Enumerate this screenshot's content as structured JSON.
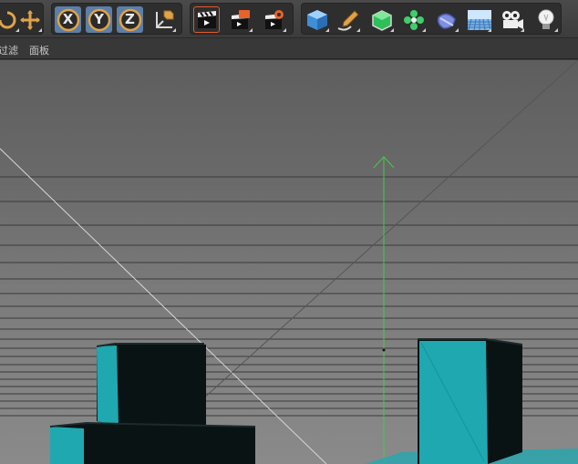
{
  "toolbar": {
    "groups": [
      {
        "name": "transform-tools",
        "buttons": [
          {
            "name": "rotate-tool-icon",
            "icon": "rotate"
          },
          {
            "name": "move-tool-icon",
            "icon": "move-cross"
          }
        ]
      },
      {
        "name": "axis-lock",
        "buttons": [
          {
            "name": "x-axis-lock-button",
            "label": "X"
          },
          {
            "name": "y-axis-lock-button",
            "label": "Y"
          },
          {
            "name": "z-axis-lock-button",
            "label": "Z"
          },
          {
            "name": "coordinate-system-button",
            "icon": "world-axis"
          }
        ]
      },
      {
        "name": "render",
        "buttons": [
          {
            "name": "render-view-button",
            "icon": "clapper-active"
          },
          {
            "name": "render-to-picture-viewer-button",
            "icon": "clapper-orange"
          },
          {
            "name": "render-settings-button",
            "icon": "clapper-gear"
          }
        ]
      },
      {
        "name": "create-objects",
        "buttons": [
          {
            "name": "cube-object-button",
            "icon": "cube"
          },
          {
            "name": "pen-spline-button",
            "icon": "pen"
          },
          {
            "name": "subdivision-button",
            "icon": "green-cube"
          },
          {
            "name": "cloner-button",
            "icon": "cloner"
          },
          {
            "name": "deformer-button",
            "icon": "deformer"
          },
          {
            "name": "floor-button",
            "icon": "floor"
          },
          {
            "name": "camera-button",
            "icon": "camera"
          },
          {
            "name": "light-button",
            "icon": "bulb"
          }
        ]
      }
    ],
    "colors": {
      "active": "#5b7fa8",
      "axis_ring": "#e0a24a",
      "cube": "#4aa3e8"
    }
  },
  "menubar": {
    "items": [
      "过滤",
      "面板"
    ]
  },
  "viewport": {
    "colors": {
      "object_face": "#1fa8b0",
      "object_dark": "#0b1516",
      "y_axis": "#48c848",
      "grid_line": "#3c3c3c"
    }
  }
}
